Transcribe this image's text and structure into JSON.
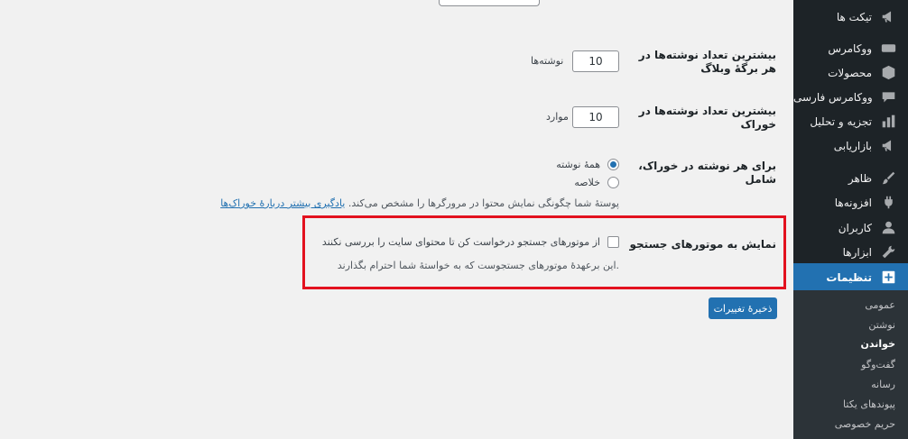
{
  "sidebar": {
    "items": [
      {
        "label": "تیکت ها",
        "icon": "megaphone-icon"
      },
      {
        "label": "ووکامرس",
        "icon": "woo-icon"
      },
      {
        "label": "محصولات",
        "icon": "box-icon"
      },
      {
        "label": "ووکامرس فارسی",
        "icon": "chat-icon"
      },
      {
        "label": "تجزیه و تحلیل",
        "icon": "bar-chart-icon"
      },
      {
        "label": "بازاریابی",
        "icon": "megaphone-icon"
      },
      {
        "label": "ظاهر",
        "icon": "brush-icon"
      },
      {
        "label": "افزونه‌ها",
        "icon": "plugin-icon"
      },
      {
        "label": "کاربران",
        "icon": "user-icon"
      },
      {
        "label": "ابزارها",
        "icon": "wrench-icon"
      },
      {
        "label": "تنظیمات",
        "icon": "settings-icon"
      }
    ],
    "submenu": [
      "عمومی",
      "نوشتن",
      "خواندن",
      "گفت‌وگو",
      "رسانه",
      "پیوندهای یکتا",
      "حریم خصوصی"
    ]
  },
  "settings": {
    "posts_per_page": {
      "label": "بیشترین تعداد نوشته‌ها در هر برگهٔ وبلاگ",
      "value": "10",
      "unit": "نوشته‌ها"
    },
    "posts_per_rss": {
      "label": "بیشترین تعداد نوشته‌ها در خوراک",
      "value": "10",
      "unit": "موارد"
    },
    "rss_use_excerpt": {
      "label": "برای هر نوشته در خوراک، شامل",
      "option_full": "همهٔ نوشته",
      "option_summary": "خلاصه",
      "description": "پوستهٔ شما چگونگی نمایش محتوا در مرورگرها را مشخص می‌کند.",
      "link_text": "یادگیری بیشتر دربارهٔ خوراک‌ها"
    },
    "search_visibility": {
      "label": "نمایش به موتورهای جستجو",
      "checkbox_label": "از موتورهای جستجو درخواست کن تا محتوای سایت را بررسی نکنند",
      "description": "این برعهدهٔ موتورهای جستجوست که به خواستهٔ شما احترام بگذارند."
    }
  },
  "save_button": "ذخیرهٔ تغییرات",
  "colors": {
    "accent": "#2271b1",
    "sidebar_bg": "#1d2327",
    "highlight": "#e3111f"
  }
}
